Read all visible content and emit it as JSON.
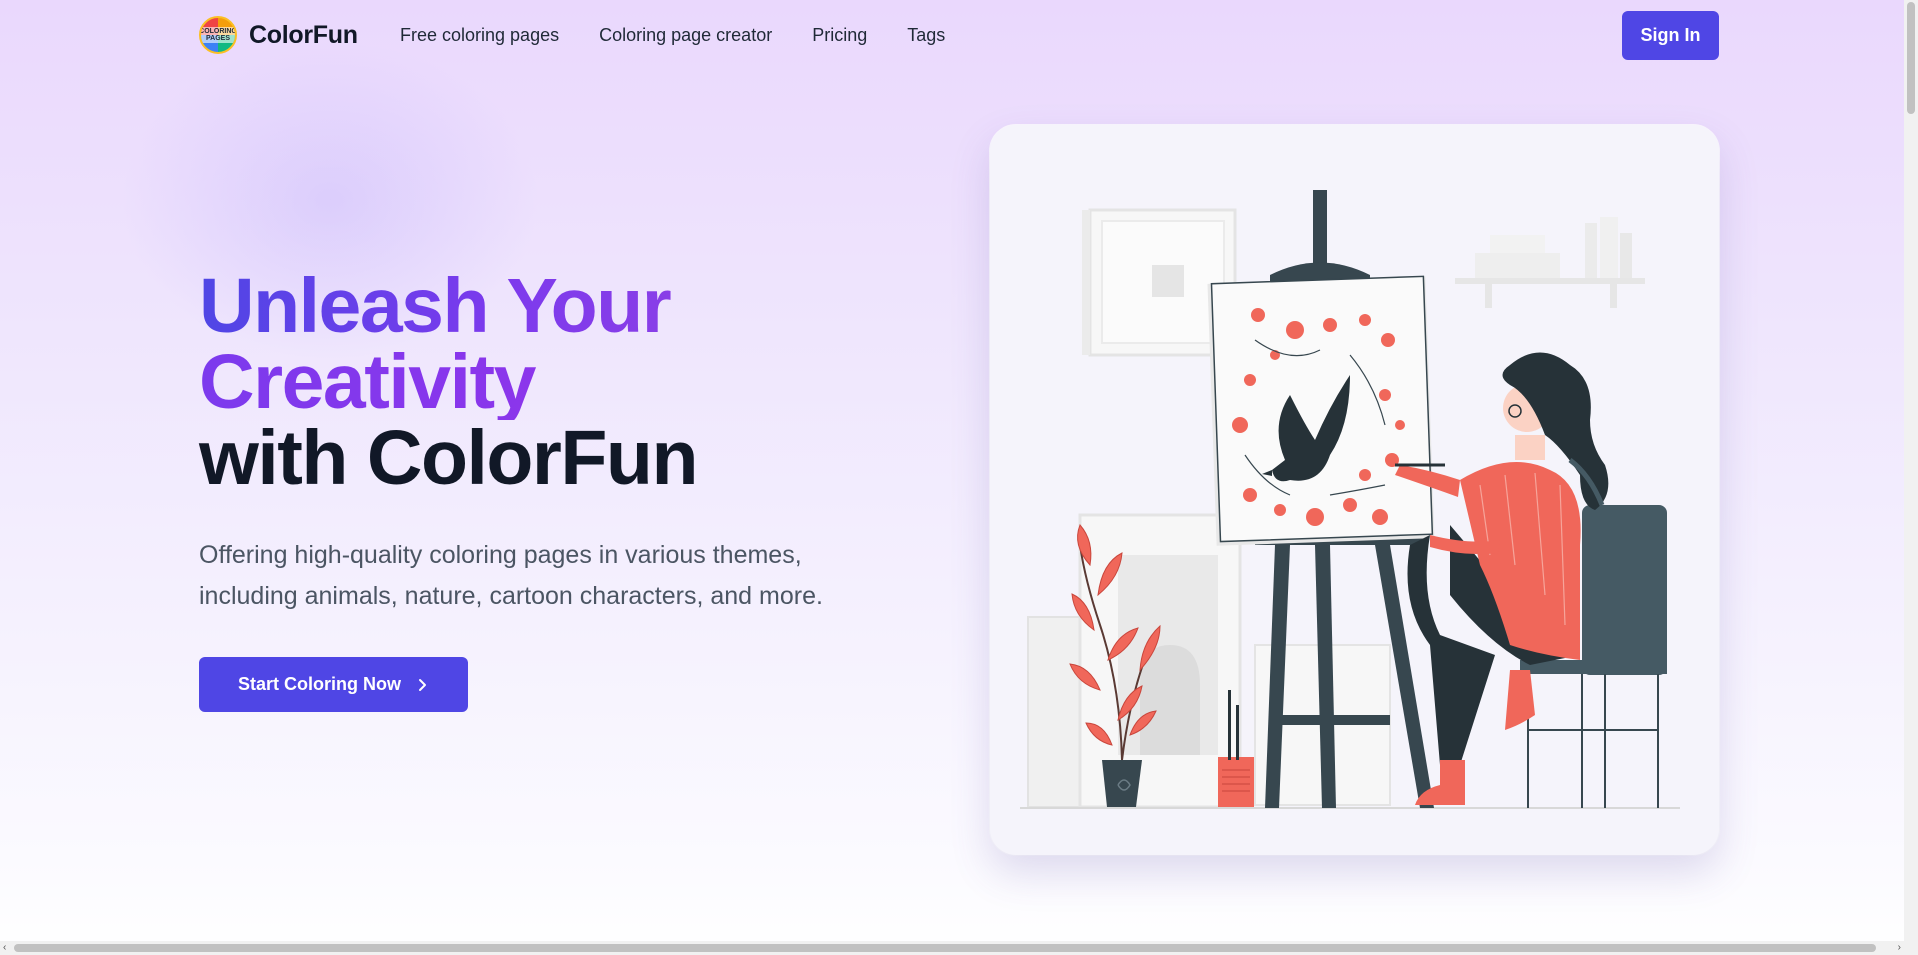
{
  "brand": {
    "name": "ColorFun",
    "logo_text": "COLORING PAGES"
  },
  "nav": {
    "links": [
      {
        "label": "Free coloring pages"
      },
      {
        "label": "Coloring page creator"
      },
      {
        "label": "Pricing"
      },
      {
        "label": "Tags"
      }
    ],
    "signin_label": "Sign In"
  },
  "hero": {
    "title_line1": "Unleash Your",
    "title_line2": "Creativity",
    "title_line3": "with ColorFun",
    "subtitle": "Offering high-quality coloring pages in various themes, including animals, nature, cartoon characters, and more.",
    "cta_label": "Start Coloring Now"
  },
  "colors": {
    "accent": "#4f46e5",
    "gradient_start": "#4f46e5",
    "gradient_end": "#9333ea",
    "illustration_coral": "#f0675a",
    "illustration_dark": "#37474f"
  },
  "icons": {
    "cta_icon": "chevron-right-icon",
    "logo_icon": "coloring-pages-badge"
  }
}
